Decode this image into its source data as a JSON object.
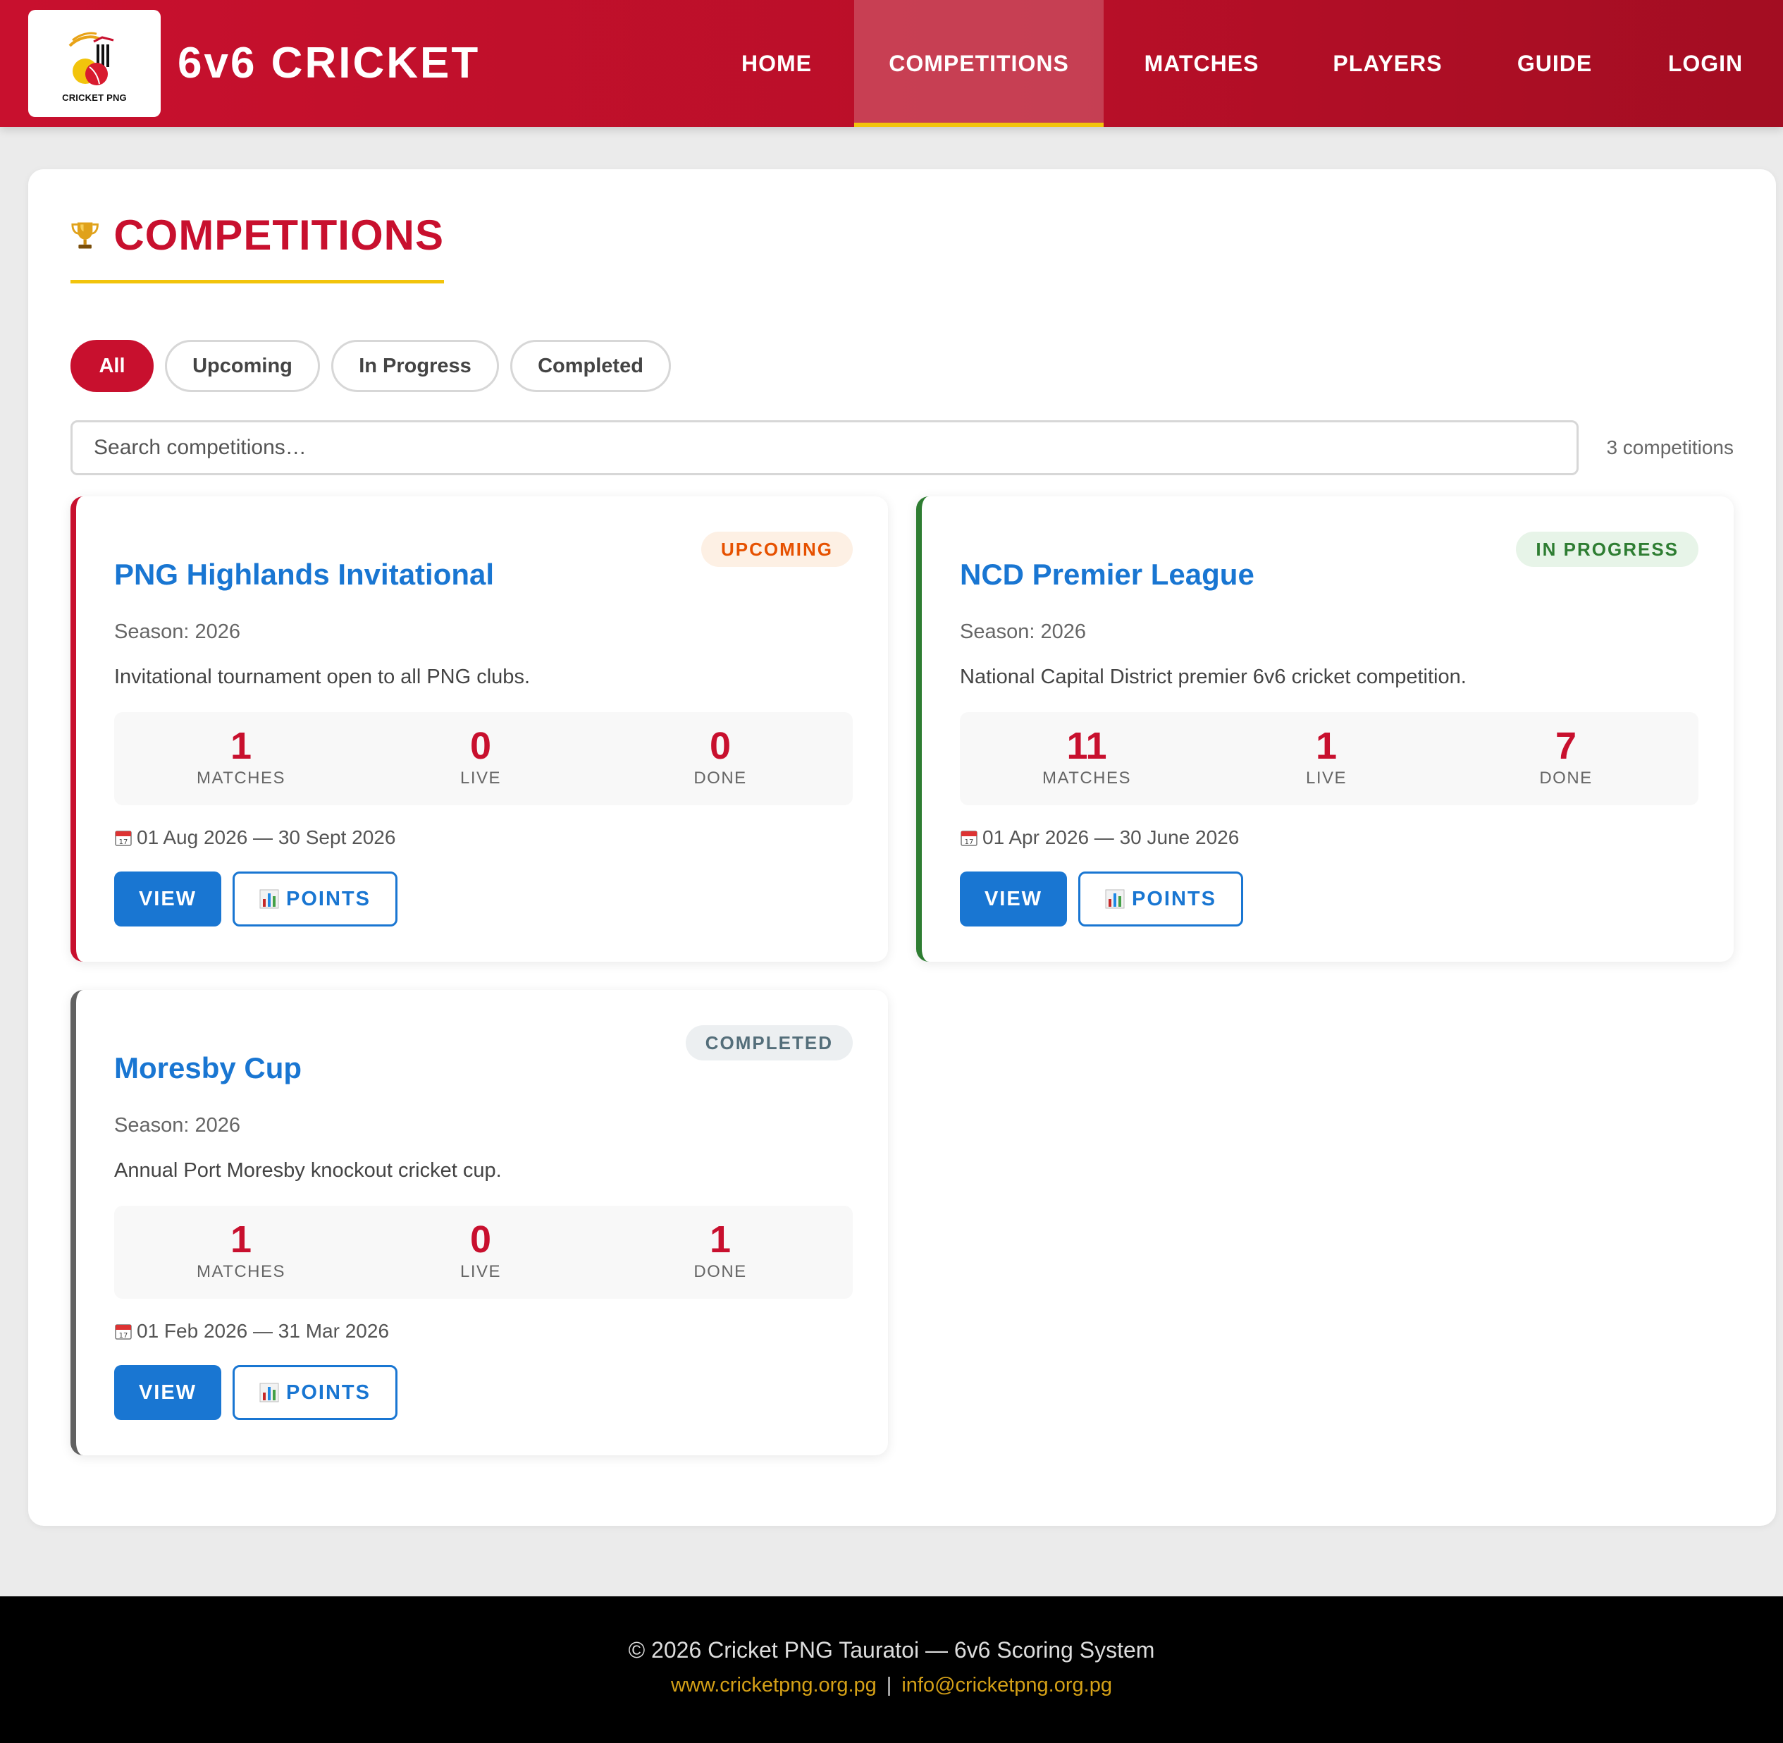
{
  "header": {
    "logo_text": "CRICKET PNG",
    "brand": "6v6 CRICKET",
    "nav": [
      {
        "label": "HOME",
        "active": false
      },
      {
        "label": "COMPETITIONS",
        "active": true
      },
      {
        "label": "MATCHES",
        "active": false
      },
      {
        "label": "PLAYERS",
        "active": false
      },
      {
        "label": "GUIDE",
        "active": false
      },
      {
        "label": "LOGIN",
        "active": false
      }
    ]
  },
  "page": {
    "title": "COMPETITIONS",
    "title_icon": "trophy-icon",
    "filters": [
      {
        "label": "All",
        "active": true
      },
      {
        "label": "Upcoming",
        "active": false
      },
      {
        "label": "In Progress",
        "active": false
      },
      {
        "label": "Completed",
        "active": false
      }
    ],
    "search_placeholder": "Search competitions…",
    "count_text": "3 competitions"
  },
  "competitions": [
    {
      "status": "UPCOMING",
      "title": "PNG Highlands Invitational",
      "season": "Season: 2026",
      "description": "Invitational tournament open to all PNG clubs.",
      "stats": [
        {
          "value": "1",
          "label": "MATCHES"
        },
        {
          "value": "0",
          "label": "LIVE"
        },
        {
          "value": "0",
          "label": "DONE"
        }
      ],
      "dates": "01 Aug 2026 — 30 Sept 2026",
      "view_label": "VIEW",
      "points_label": "POINTS"
    },
    {
      "status": "IN PROGRESS",
      "title": "NCD Premier League",
      "season": "Season: 2026",
      "description": "National Capital District premier 6v6 cricket competition.",
      "stats": [
        {
          "value": "11",
          "label": "MATCHES"
        },
        {
          "value": "1",
          "label": "LIVE"
        },
        {
          "value": "7",
          "label": "DONE"
        }
      ],
      "dates": "01 Apr 2026 — 30 June 2026",
      "view_label": "VIEW",
      "points_label": "POINTS"
    },
    {
      "status": "COMPLETED",
      "title": "Moresby Cup",
      "season": "Season: 2026",
      "description": "Annual Port Moresby knockout cricket cup.",
      "stats": [
        {
          "value": "1",
          "label": "MATCHES"
        },
        {
          "value": "0",
          "label": "LIVE"
        },
        {
          "value": "1",
          "label": "DONE"
        }
      ],
      "dates": "01 Feb 2026 — 31 Mar 2026",
      "view_label": "VIEW",
      "points_label": "POINTS"
    }
  ],
  "footer": {
    "copyright": "© 2026 Cricket PNG Tauratoi — 6v6 Scoring System",
    "website": "www.cricketpng.org.pg",
    "separator": "|",
    "email": "info@cricketpng.org.pg"
  },
  "colors": {
    "brand_red": "#c8102e",
    "accent_yellow": "#f2c40c",
    "link_blue": "#1976d2",
    "status_upcoming": "#e65100",
    "status_in_progress": "#2e7d32",
    "status_completed": "#546e7a"
  }
}
